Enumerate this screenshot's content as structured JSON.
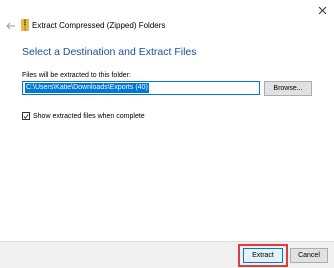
{
  "window": {
    "title": "Extract Compressed (Zipped) Folders",
    "close_icon": "close-icon",
    "back_icon": "back-arrow-icon",
    "folder_icon": "zip-folder-icon"
  },
  "main": {
    "heading": "Select a Destination and Extract Files",
    "destination_label": "Files will be extracted to this folder:",
    "destination_path": "C:\\Users\\Katie\\Downloads\\Exports (40)",
    "browse_label": "Browse...",
    "show_files_label": "Show extracted files when complete",
    "show_files_checked": true
  },
  "footer": {
    "extract_label": "Extract",
    "cancel_label": "Cancel"
  },
  "colors": {
    "heading": "#1a4f9c",
    "selection": "#0078d7",
    "highlight": "#e03c3c"
  }
}
